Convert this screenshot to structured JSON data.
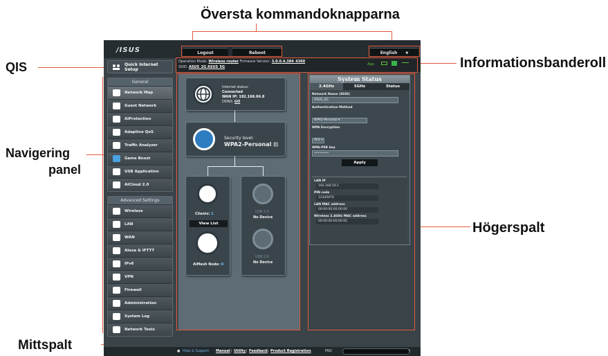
{
  "annotations": {
    "top_buttons": "Översta kommandoknapparna",
    "qis": "QIS",
    "info_banner": "Informationsbanderoll",
    "nav_panel_line1": "Navigering",
    "nav_panel_line2": "panel",
    "right_column": "Högerspalt",
    "center_column": "Mittspalt"
  },
  "topbar": {
    "logo": "/ISUS",
    "logout": "Logout",
    "reboot": "Reboot",
    "language": "English",
    "language_arrow": "▼"
  },
  "info": {
    "op_mode_label": "Operation Mode:",
    "op_mode_value": "Wireless router",
    "fw_label": "Firmware Version:",
    "fw_value": "3.0.0.4.384_4360",
    "ssid_label": "SSID:",
    "ssid_values": "ASUS_2G  ASUS_5G",
    "app_label": "App"
  },
  "sidebar": {
    "qis": "Quick Internet Setup",
    "general_header": "General",
    "general_items": [
      "Network Map",
      "Guest Network",
      "AiProtection",
      "Adaptive QoS",
      "Traffic Analyzer",
      "Game Boost",
      "USB Application",
      "AiCloud 2.0"
    ],
    "advanced_header": "Advanced Settings",
    "advanced_items": [
      "Wireless",
      "LAN",
      "WAN",
      "Alexa & IFTTT",
      "IPv6",
      "VPN",
      "Firewall",
      "Administration",
      "System Log",
      "Network Tools"
    ]
  },
  "center": {
    "internet_status_label": "Internet status:",
    "internet_status_value": "Connected",
    "wan_ip": "WAN IP: 192.168.66.8",
    "ddns": "DDNS:",
    "ddns_value": "GO",
    "security_label": "Security level:",
    "security_value": "WPA2-Personal",
    "clients_label": "Clients:",
    "clients_value": "1",
    "view_list": "View List",
    "aimesh_label": "AiMesh Node:",
    "aimesh_value": "0",
    "usb1_label": "USB 3.0",
    "usb1_status": "No Device",
    "usb2_label": "USB 2.0",
    "usb2_status": "No Device"
  },
  "right": {
    "title": "System Status",
    "tabs": [
      "2.4GHz",
      "5GHz",
      "Status"
    ],
    "ssid_label": "Network Name (SSID)",
    "ssid_value": "ASUS_2G",
    "auth_label": "Authentication Method",
    "auth_value": "WPA2-Personal",
    "enc_label": "WPA Encryption",
    "enc_value": "AES",
    "psk_label": "WPA-PSK key",
    "psk_value": "••••••••",
    "apply": "Apply",
    "lan_ip_label": "LAN IP",
    "lan_ip_value": "192.168.50.1",
    "pin_label": "PIN code",
    "pin_value": "12345670",
    "mac_label": "LAN MAC address",
    "mac_value": "00:00:00:00:00:00",
    "wmac_label": "Wireless 2.4GHz MAC address",
    "wmac_value": "00:00:00:00:00:00"
  },
  "footer": {
    "help": "Help & Support",
    "manual": "Manual",
    "sep1": "|",
    "utility": "Utility",
    "sep2": "|",
    "feedback": "Feedback",
    "sep3": "|",
    "registration": "Product Registration",
    "faq": "FAQ"
  },
  "colors": {
    "annotation_line": "#e35a3c",
    "panel_bg": "#3a4348",
    "center_bg": "#5e6c75"
  }
}
